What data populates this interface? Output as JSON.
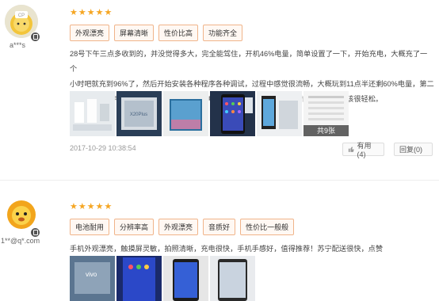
{
  "reviews": [
    {
      "username": "a***s",
      "stars": "★★★★★",
      "tags": [
        "外观漂亮",
        "屏幕清晰",
        "性价比高",
        "功能齐全"
      ],
      "text_lines": [
        "28号下午三点多收到的，并没觉得多大，完全能驾住，开机46%电量，简单设置了一下，开始充电，大概充了一个",
        "小时吧就充到96%了，然后开始安装各种程序各种调试，过程中感觉很流畅，大概玩到11点半还剩60%电量，第二",
        "天早上继续充电到99%开玩，玩了四个小时电量还剩80%，续航还是不错的，用一天应该很轻松。"
      ],
      "photo_count": "共9张",
      "date": "2017-10-29 10:38:54",
      "useful_label": "有用(4)",
      "reply_label": "回复(0)"
    },
    {
      "username": "1**@q*.com",
      "stars": "★★★★★",
      "tags": [
        "电池耐用",
        "分辨率高",
        "外观漂亮",
        "音质好",
        "性价比一般般"
      ],
      "text_lines": [
        "手机外观漂亮，触摸屏灵敏，拍照清晰，充电很快，手机手感好，值得推荐！苏宁配送很快，点赞"
      ]
    }
  ],
  "colors": {
    "star": "#f5a623",
    "tag_border": "#f0b48a",
    "tag_bg": "#fff8f3"
  }
}
